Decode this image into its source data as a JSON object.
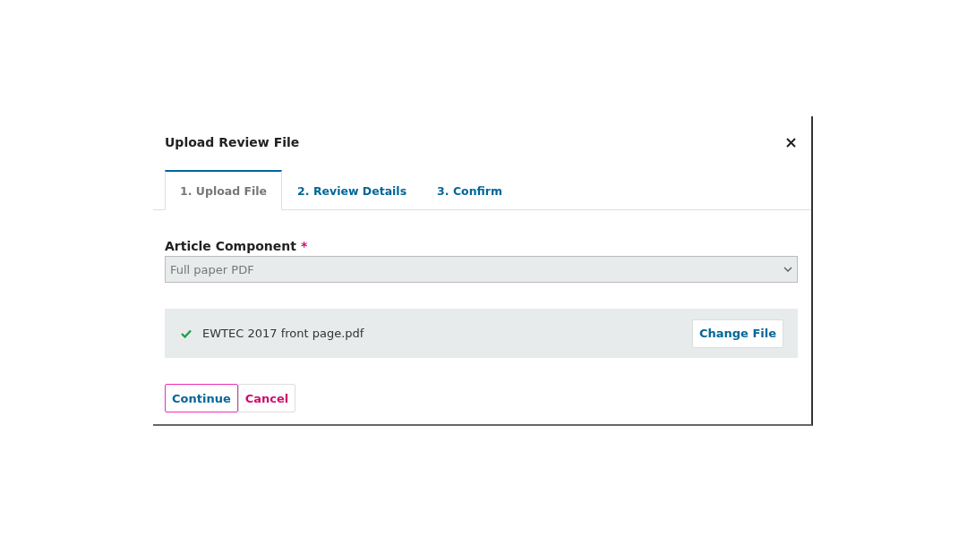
{
  "dialog": {
    "title": "Upload Review File"
  },
  "tabs": [
    {
      "label": "1. Upload File",
      "selected": true
    },
    {
      "label": "2. Review Details",
      "selected": false
    },
    {
      "label": "3. Confirm",
      "selected": false
    }
  ],
  "field": {
    "label": "Article Component",
    "required_mark": "*",
    "value": "Full paper PDF"
  },
  "file": {
    "name": "EWTEC 2017 front page.pdf",
    "uploaded": true,
    "button": "Change File"
  },
  "buttons": [
    {
      "label": "Continue",
      "kind": "primary",
      "focused": true
    },
    {
      "label": "Cancel",
      "kind": "cancel",
      "focused": false
    }
  ]
}
